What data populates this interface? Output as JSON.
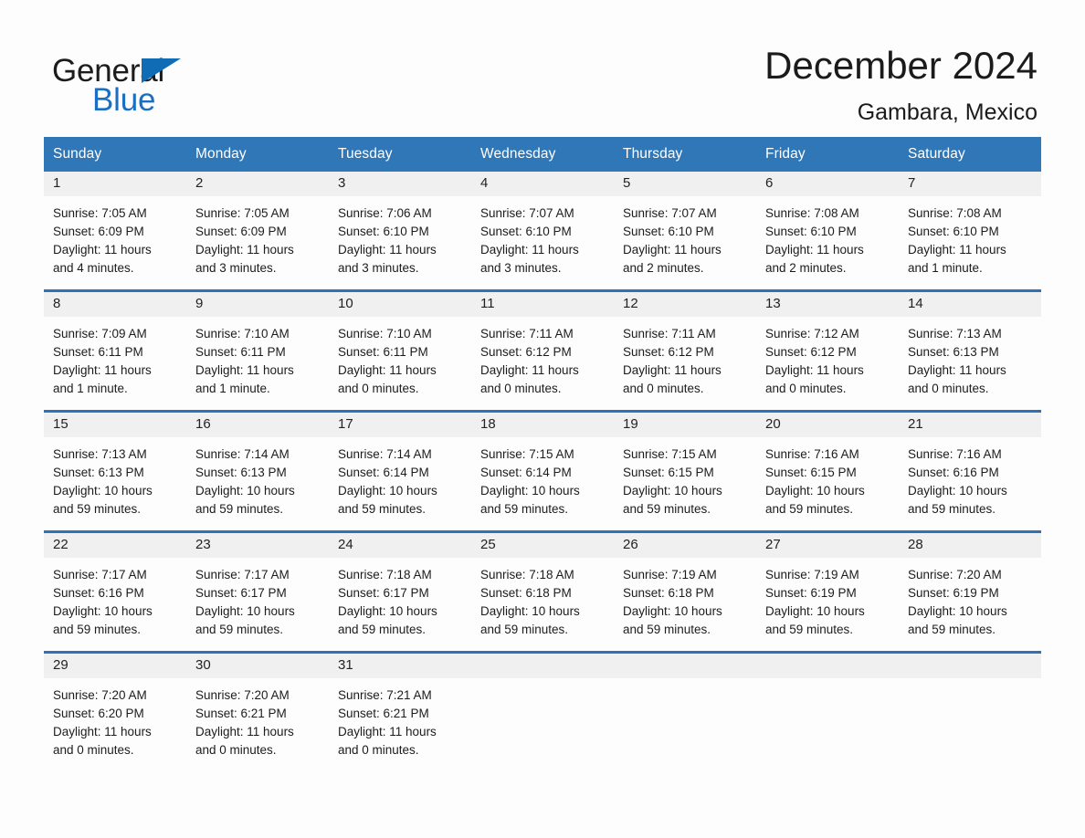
{
  "brand": {
    "name_part1": "General",
    "name_part2": "Blue",
    "triangle_color": "#106cb5",
    "blue_color": "#1a6fc4"
  },
  "header": {
    "title": "December 2024",
    "subtitle": "Gambara, Mexico",
    "header_bg": "#3077b8",
    "row_divider": "#2d72b5",
    "day_band_bg": "#f0f0f0"
  },
  "weekdays": [
    "Sunday",
    "Monday",
    "Tuesday",
    "Wednesday",
    "Thursday",
    "Friday",
    "Saturday"
  ],
  "labels": {
    "sunrise": "Sunrise:",
    "sunset": "Sunset:",
    "daylight": "Daylight:"
  },
  "weeks": [
    [
      {
        "day": "1",
        "sunrise": "Sunrise: 7:05 AM",
        "sunset": "Sunset: 6:09 PM",
        "daylight": "Daylight: 11 hours and 4 minutes."
      },
      {
        "day": "2",
        "sunrise": "Sunrise: 7:05 AM",
        "sunset": "Sunset: 6:09 PM",
        "daylight": "Daylight: 11 hours and 3 minutes."
      },
      {
        "day": "3",
        "sunrise": "Sunrise: 7:06 AM",
        "sunset": "Sunset: 6:10 PM",
        "daylight": "Daylight: 11 hours and 3 minutes."
      },
      {
        "day": "4",
        "sunrise": "Sunrise: 7:07 AM",
        "sunset": "Sunset: 6:10 PM",
        "daylight": "Daylight: 11 hours and 3 minutes."
      },
      {
        "day": "5",
        "sunrise": "Sunrise: 7:07 AM",
        "sunset": "Sunset: 6:10 PM",
        "daylight": "Daylight: 11 hours and 2 minutes."
      },
      {
        "day": "6",
        "sunrise": "Sunrise: 7:08 AM",
        "sunset": "Sunset: 6:10 PM",
        "daylight": "Daylight: 11 hours and 2 minutes."
      },
      {
        "day": "7",
        "sunrise": "Sunrise: 7:08 AM",
        "sunset": "Sunset: 6:10 PM",
        "daylight": "Daylight: 11 hours and 1 minute."
      }
    ],
    [
      {
        "day": "8",
        "sunrise": "Sunrise: 7:09 AM",
        "sunset": "Sunset: 6:11 PM",
        "daylight": "Daylight: 11 hours and 1 minute."
      },
      {
        "day": "9",
        "sunrise": "Sunrise: 7:10 AM",
        "sunset": "Sunset: 6:11 PM",
        "daylight": "Daylight: 11 hours and 1 minute."
      },
      {
        "day": "10",
        "sunrise": "Sunrise: 7:10 AM",
        "sunset": "Sunset: 6:11 PM",
        "daylight": "Daylight: 11 hours and 0 minutes."
      },
      {
        "day": "11",
        "sunrise": "Sunrise: 7:11 AM",
        "sunset": "Sunset: 6:12 PM",
        "daylight": "Daylight: 11 hours and 0 minutes."
      },
      {
        "day": "12",
        "sunrise": "Sunrise: 7:11 AM",
        "sunset": "Sunset: 6:12 PM",
        "daylight": "Daylight: 11 hours and 0 minutes."
      },
      {
        "day": "13",
        "sunrise": "Sunrise: 7:12 AM",
        "sunset": "Sunset: 6:12 PM",
        "daylight": "Daylight: 11 hours and 0 minutes."
      },
      {
        "day": "14",
        "sunrise": "Sunrise: 7:13 AM",
        "sunset": "Sunset: 6:13 PM",
        "daylight": "Daylight: 11 hours and 0 minutes."
      }
    ],
    [
      {
        "day": "15",
        "sunrise": "Sunrise: 7:13 AM",
        "sunset": "Sunset: 6:13 PM",
        "daylight": "Daylight: 10 hours and 59 minutes."
      },
      {
        "day": "16",
        "sunrise": "Sunrise: 7:14 AM",
        "sunset": "Sunset: 6:13 PM",
        "daylight": "Daylight: 10 hours and 59 minutes."
      },
      {
        "day": "17",
        "sunrise": "Sunrise: 7:14 AM",
        "sunset": "Sunset: 6:14 PM",
        "daylight": "Daylight: 10 hours and 59 minutes."
      },
      {
        "day": "18",
        "sunrise": "Sunrise: 7:15 AM",
        "sunset": "Sunset: 6:14 PM",
        "daylight": "Daylight: 10 hours and 59 minutes."
      },
      {
        "day": "19",
        "sunrise": "Sunrise: 7:15 AM",
        "sunset": "Sunset: 6:15 PM",
        "daylight": "Daylight: 10 hours and 59 minutes."
      },
      {
        "day": "20",
        "sunrise": "Sunrise: 7:16 AM",
        "sunset": "Sunset: 6:15 PM",
        "daylight": "Daylight: 10 hours and 59 minutes."
      },
      {
        "day": "21",
        "sunrise": "Sunrise: 7:16 AM",
        "sunset": "Sunset: 6:16 PM",
        "daylight": "Daylight: 10 hours and 59 minutes."
      }
    ],
    [
      {
        "day": "22",
        "sunrise": "Sunrise: 7:17 AM",
        "sunset": "Sunset: 6:16 PM",
        "daylight": "Daylight: 10 hours and 59 minutes."
      },
      {
        "day": "23",
        "sunrise": "Sunrise: 7:17 AM",
        "sunset": "Sunset: 6:17 PM",
        "daylight": "Daylight: 10 hours and 59 minutes."
      },
      {
        "day": "24",
        "sunrise": "Sunrise: 7:18 AM",
        "sunset": "Sunset: 6:17 PM",
        "daylight": "Daylight: 10 hours and 59 minutes."
      },
      {
        "day": "25",
        "sunrise": "Sunrise: 7:18 AM",
        "sunset": "Sunset: 6:18 PM",
        "daylight": "Daylight: 10 hours and 59 minutes."
      },
      {
        "day": "26",
        "sunrise": "Sunrise: 7:19 AM",
        "sunset": "Sunset: 6:18 PM",
        "daylight": "Daylight: 10 hours and 59 minutes."
      },
      {
        "day": "27",
        "sunrise": "Sunrise: 7:19 AM",
        "sunset": "Sunset: 6:19 PM",
        "daylight": "Daylight: 10 hours and 59 minutes."
      },
      {
        "day": "28",
        "sunrise": "Sunrise: 7:20 AM",
        "sunset": "Sunset: 6:19 PM",
        "daylight": "Daylight: 10 hours and 59 minutes."
      }
    ],
    [
      {
        "day": "29",
        "sunrise": "Sunrise: 7:20 AM",
        "sunset": "Sunset: 6:20 PM",
        "daylight": "Daylight: 11 hours and 0 minutes."
      },
      {
        "day": "30",
        "sunrise": "Sunrise: 7:20 AM",
        "sunset": "Sunset: 6:21 PM",
        "daylight": "Daylight: 11 hours and 0 minutes."
      },
      {
        "day": "31",
        "sunrise": "Sunrise: 7:21 AM",
        "sunset": "Sunset: 6:21 PM",
        "daylight": "Daylight: 11 hours and 0 minutes."
      },
      {
        "day": "",
        "sunrise": "",
        "sunset": "",
        "daylight": ""
      },
      {
        "day": "",
        "sunrise": "",
        "sunset": "",
        "daylight": ""
      },
      {
        "day": "",
        "sunrise": "",
        "sunset": "",
        "daylight": ""
      },
      {
        "day": "",
        "sunrise": "",
        "sunset": "",
        "daylight": ""
      }
    ]
  ]
}
